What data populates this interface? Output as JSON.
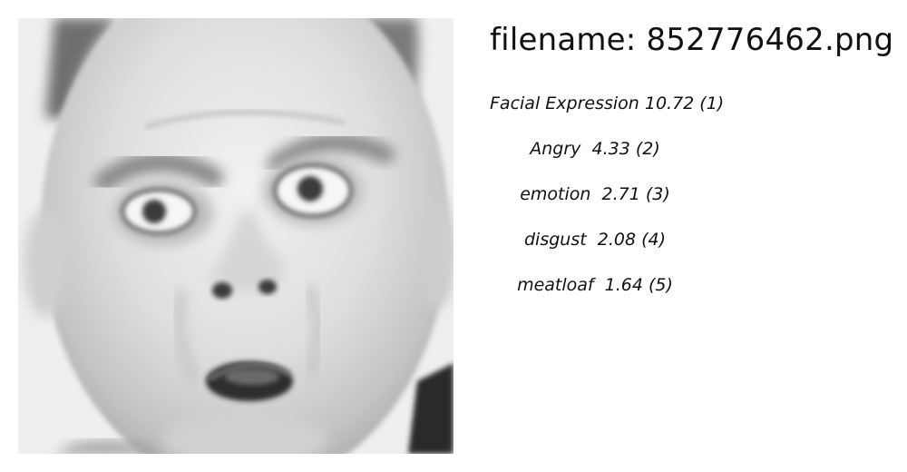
{
  "image": {
    "subject": "grayscale close-up face with surprised expression"
  },
  "header": {
    "filename_label": "filename:",
    "filename": "852776462.png",
    "title": "filename: 852776462.png"
  },
  "predictions": [
    {
      "label": "Facial Expression",
      "score": "10.72",
      "rank": "(1)",
      "text": "Facial Expression 10.72 (1)"
    },
    {
      "label": "Angry",
      "score": "4.33",
      "rank": "(2)",
      "text": "Angry  4.33 (2)"
    },
    {
      "label": "emotion",
      "score": "2.71",
      "rank": "(3)",
      "text": "emotion  2.71 (3)"
    },
    {
      "label": "disgust",
      "score": "2.08",
      "rank": "(4)",
      "text": "disgust  2.08 (4)"
    },
    {
      "label": "meatloaf",
      "score": "1.64",
      "rank": "(5)",
      "text": "meatloaf  1.64 (5)"
    }
  ],
  "colors": {
    "background": "#ffffff",
    "text": "#111111",
    "photo_skin": "#dcdcdc",
    "photo_dark": "#2a2a2a"
  }
}
